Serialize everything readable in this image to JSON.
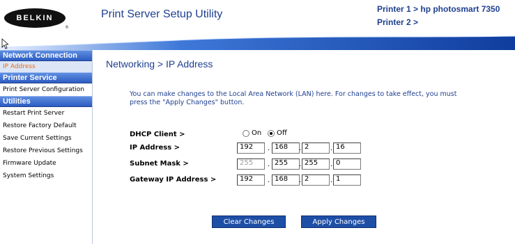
{
  "header": {
    "logo_text": "BELKIN",
    "logo_reg": "®",
    "title": "Print Server Setup Utility",
    "printer1": "Printer 1 > hp photosmart 7350",
    "printer2": "Printer 2 >"
  },
  "sidebar": {
    "sections": [
      {
        "heading": "Network Connection",
        "items": [
          "IP Address"
        ]
      },
      {
        "heading": "Printer Service",
        "items": [
          "Print Server Configuration"
        ]
      },
      {
        "heading": "Utilities",
        "items": [
          "Restart Print Server",
          "Restore Factory Default",
          "Save Current Settings",
          "Restore Previous Settings",
          "Firmware Update",
          "System Settings"
        ]
      }
    ],
    "active_item": "IP Address"
  },
  "main": {
    "title": "Networking > IP Address",
    "intro": "You can make changes to the Local Area Network (LAN) here. For changes to take effect, you must press the \"Apply Changes\" button.",
    "dhcp": {
      "label": "DHCP Client >",
      "on_label": "On",
      "off_label": "Off",
      "selected": "Off"
    },
    "ip": {
      "label": "IP Address >",
      "octets": [
        "192",
        "168",
        "2",
        "16"
      ]
    },
    "subnet": {
      "label": "Subnet Mask >",
      "octets": [
        "255",
        "255",
        "255",
        "0"
      ]
    },
    "gateway": {
      "label": "Gateway IP Address >",
      "octets": [
        "192",
        "168",
        "2",
        "1"
      ]
    },
    "dot": ".",
    "clear_button": "Clear Changes",
    "apply_button": "Apply Changes"
  },
  "colors": {
    "brand_blue": "#1e3f8f",
    "sidebar_header": "#2d5cc3",
    "active_item": "#e36c1a",
    "button": "#1e4fa6"
  }
}
